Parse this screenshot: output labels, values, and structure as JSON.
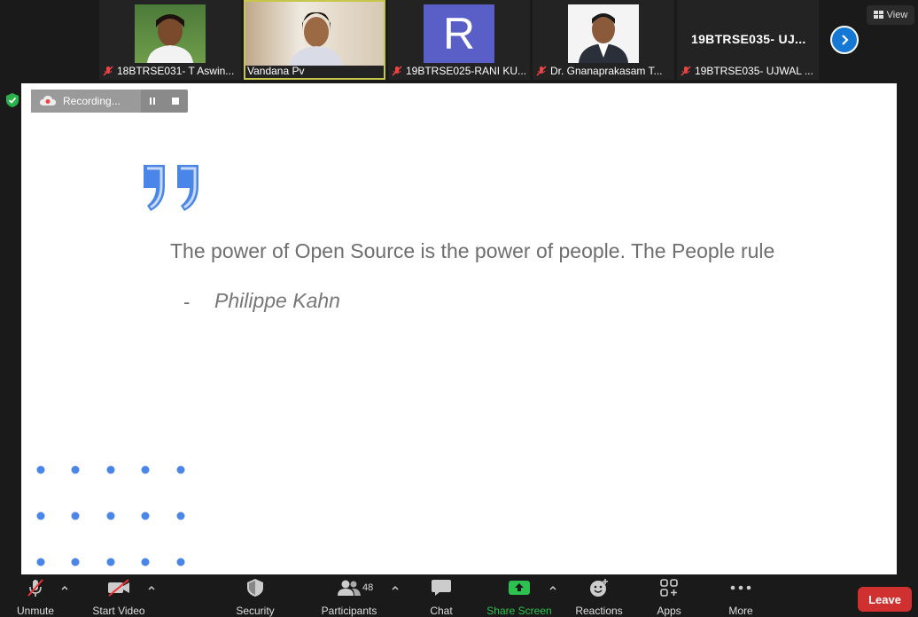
{
  "participants_strip": [
    {
      "name": "18BTRSE031- T Aswin...",
      "muted": true,
      "kind": "photo"
    },
    {
      "name": "Vandana Pv",
      "muted": false,
      "kind": "photo",
      "active": true
    },
    {
      "name": "19BTRSE025-RANI KU...",
      "muted": true,
      "kind": "initial",
      "initial": "R"
    },
    {
      "name": "Dr. Gnanaprakasam T...",
      "muted": true,
      "kind": "photo"
    },
    {
      "name": "19BTRSE035- UJWAL ...",
      "muted": true,
      "kind": "text",
      "big_name": "19BTRSE035- UJ..."
    }
  ],
  "view_label": "View",
  "recording_label": "Recording...",
  "slide": {
    "quote": "The power of Open Source is the power of people. The People rule",
    "dash": "-",
    "author": "Philippe Kahn"
  },
  "toolbar": {
    "unmute": "Unmute",
    "start_video": "Start Video",
    "security": "Security",
    "participants": "Participants",
    "participants_count": "48",
    "chat": "Chat",
    "share_screen": "Share Screen",
    "reactions": "Reactions",
    "apps": "Apps",
    "more": "More",
    "leave": "Leave"
  },
  "colors": {
    "accent_blue": "#1478d4",
    "leave_red": "#d0302f",
    "share_green": "#2dc24f",
    "quote_blue": "#4a86e8",
    "initial_tile": "#5a5fc7"
  }
}
